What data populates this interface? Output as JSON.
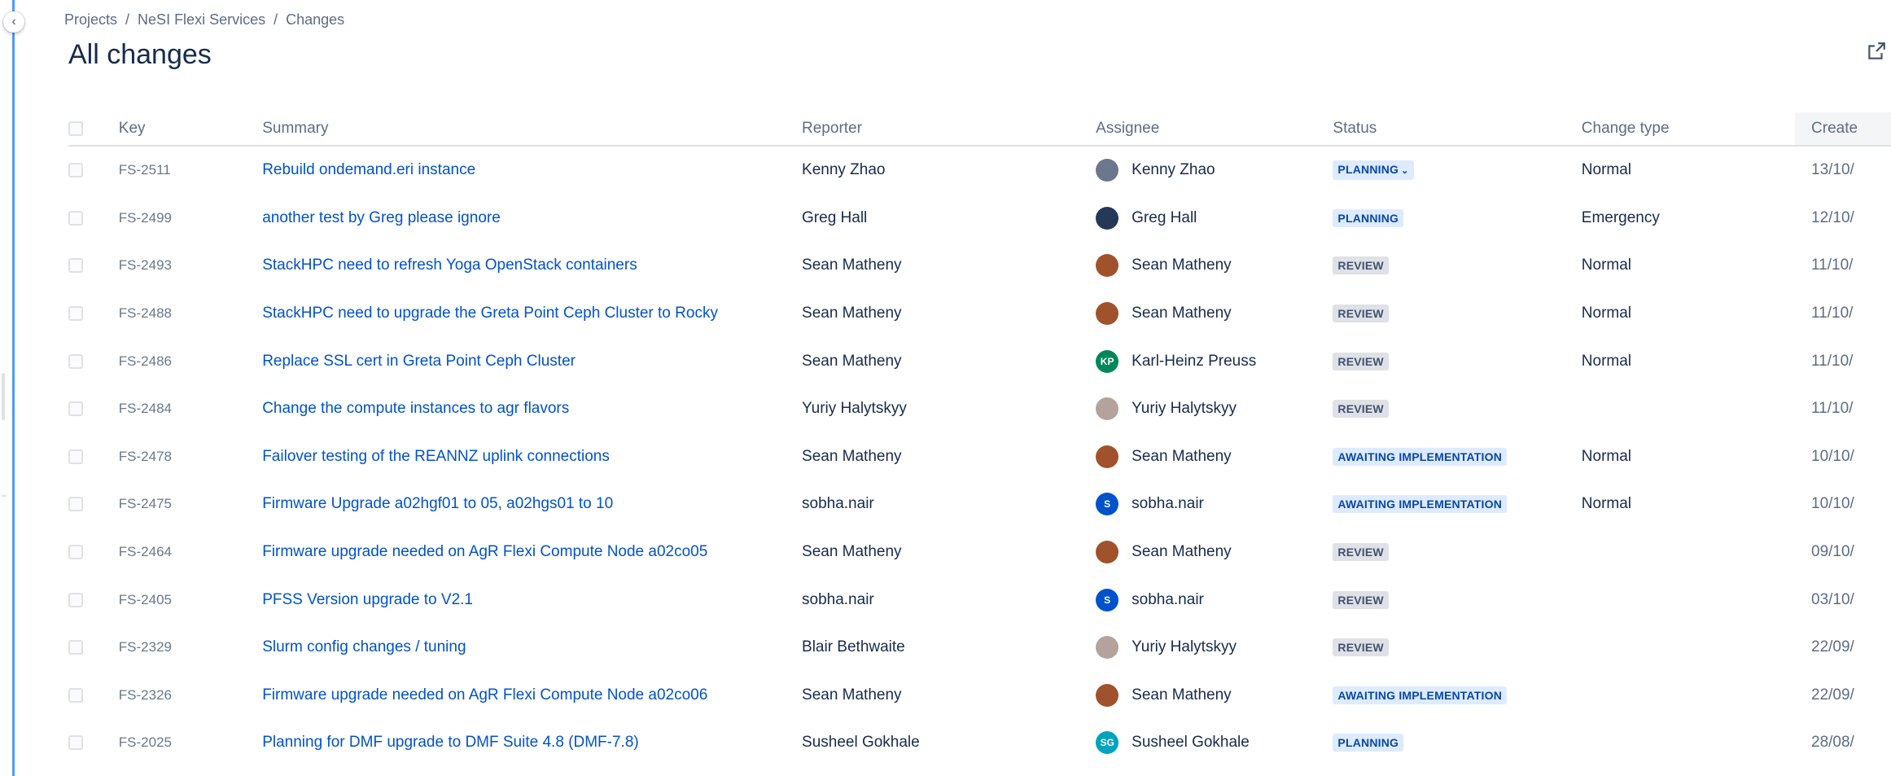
{
  "breadcrumb": [
    "Projects",
    "NeSI Flexi Services",
    "Changes"
  ],
  "page_title": "All changes",
  "columns": {
    "key": "Key",
    "summary": "Summary",
    "reporter": "Reporter",
    "assignee": "Assignee",
    "status": "Status",
    "change_type": "Change type",
    "created": "Create"
  },
  "colors": {
    "accent": "#0052cc",
    "sidebar_line": "#4c9aff",
    "lozenge_blue_bg": "#deebff",
    "lozenge_grey_bg": "#dfe1e6"
  },
  "rows": [
    {
      "key": "FS-2511",
      "summary": "Rebuild ondemand.eri instance",
      "reporter": "Kenny Zhao",
      "assignee": "Kenny Zhao",
      "avatar_initials": "",
      "avatar_color": "#6b778c",
      "status": "PLANNING",
      "status_dropdown": "⌄",
      "status_color": "blue",
      "change_type": "Normal",
      "created": "13/10/"
    },
    {
      "key": "FS-2499",
      "summary": "another test by Greg please ignore",
      "reporter": "Greg Hall",
      "assignee": "Greg Hall",
      "avatar_initials": "",
      "avatar_color": "#253858",
      "status": "PLANNING",
      "status_dropdown": "",
      "status_color": "blue",
      "change_type": "Emergency",
      "created": "12/10/"
    },
    {
      "key": "FS-2493",
      "summary": "StackHPC need to refresh Yoga OpenStack containers",
      "reporter": "Sean Matheny",
      "assignee": "Sean Matheny",
      "avatar_initials": "",
      "avatar_color": "#a0522d",
      "status": "REVIEW",
      "status_dropdown": "",
      "status_color": "grey",
      "change_type": "Normal",
      "created": "11/10/"
    },
    {
      "key": "FS-2488",
      "summary": "StackHPC need to upgrade the Greta Point Ceph Cluster to Rocky",
      "reporter": "Sean Matheny",
      "assignee": "Sean Matheny",
      "avatar_initials": "",
      "avatar_color": "#a0522d",
      "status": "REVIEW",
      "status_dropdown": "",
      "status_color": "grey",
      "change_type": "Normal",
      "created": "11/10/"
    },
    {
      "key": "FS-2486",
      "summary": "Replace SSL cert in Greta Point Ceph Cluster",
      "reporter": "Sean Matheny",
      "assignee": "Karl-Heinz Preuss",
      "avatar_initials": "KP",
      "avatar_color": "#00875a",
      "status": "REVIEW",
      "status_dropdown": "",
      "status_color": "grey",
      "change_type": "Normal",
      "created": "11/10/"
    },
    {
      "key": "FS-2484",
      "summary": "Change the compute instances to agr flavors",
      "reporter": "Yuriy Halytskyy",
      "assignee": "Yuriy Halytskyy",
      "avatar_initials": "",
      "avatar_color": "#b3a39a",
      "status": "REVIEW",
      "status_dropdown": "",
      "status_color": "grey",
      "change_type": "",
      "created": "11/10/"
    },
    {
      "key": "FS-2478",
      "summary": "Failover testing of the REANNZ uplink connections",
      "reporter": "Sean Matheny",
      "assignee": "Sean Matheny",
      "avatar_initials": "",
      "avatar_color": "#a0522d",
      "status": "AWAITING IMPLEMENTATION",
      "status_dropdown": "",
      "status_color": "blue",
      "change_type": "Normal",
      "created": "10/10/"
    },
    {
      "key": "FS-2475",
      "summary": "Firmware Upgrade a02hgf01 to 05, a02hgs01 to 10",
      "reporter": "sobha.nair",
      "assignee": "sobha.nair",
      "avatar_initials": "S",
      "avatar_color": "#0052cc",
      "status": "AWAITING IMPLEMENTATION",
      "status_dropdown": "",
      "status_color": "blue",
      "change_type": "Normal",
      "created": "10/10/"
    },
    {
      "key": "FS-2464",
      "summary": "Firmware upgrade needed on AgR Flexi Compute Node a02co05",
      "reporter": "Sean Matheny",
      "assignee": "Sean Matheny",
      "avatar_initials": "",
      "avatar_color": "#a0522d",
      "status": "REVIEW",
      "status_dropdown": "",
      "status_color": "grey",
      "change_type": "",
      "created": "09/10/"
    },
    {
      "key": "FS-2405",
      "summary": "PFSS Version upgrade to V2.1",
      "reporter": "sobha.nair",
      "assignee": "sobha.nair",
      "avatar_initials": "S",
      "avatar_color": "#0052cc",
      "status": "REVIEW",
      "status_dropdown": "",
      "status_color": "grey",
      "change_type": "",
      "created": "03/10/"
    },
    {
      "key": "FS-2329",
      "summary": "Slurm config changes / tuning",
      "reporter": "Blair Bethwaite",
      "assignee": "Yuriy Halytskyy",
      "avatar_initials": "",
      "avatar_color": "#b3a39a",
      "status": "REVIEW",
      "status_dropdown": "",
      "status_color": "grey",
      "change_type": "",
      "created": "22/09/"
    },
    {
      "key": "FS-2326",
      "summary": "Firmware upgrade needed on AgR Flexi Compute Node a02co06",
      "reporter": "Sean Matheny",
      "assignee": "Sean Matheny",
      "avatar_initials": "",
      "avatar_color": "#a0522d",
      "status": "AWAITING IMPLEMENTATION",
      "status_dropdown": "",
      "status_color": "blue",
      "change_type": "",
      "created": "22/09/"
    },
    {
      "key": "FS-2025",
      "summary": "Planning for DMF upgrade to DMF Suite 4.8 (DMF-7.8)",
      "reporter": "Susheel Gokhale",
      "assignee": "Susheel Gokhale",
      "avatar_initials": "SG",
      "avatar_color": "#00a3bf",
      "status": "PLANNING",
      "status_dropdown": "",
      "status_color": "blue",
      "change_type": "",
      "created": "28/08/"
    }
  ]
}
